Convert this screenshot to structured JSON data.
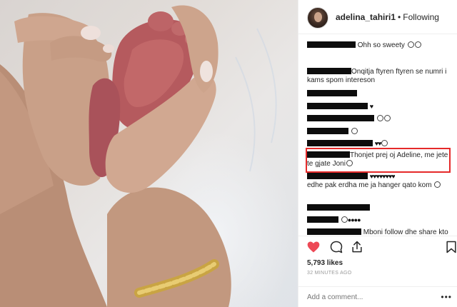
{
  "post": {
    "username": "adelina_tahiri1",
    "separator": "•",
    "follow_status": "Following"
  },
  "comments": [
    {
      "text": "Ohh so sweety"
    },
    {
      "text": "Onqitja ftyren ftyren se numri i kams spom intereson"
    },
    {
      "text": ""
    },
    {
      "text": ""
    },
    {
      "text": ""
    },
    {
      "text": ""
    },
    {
      "text": ""
    },
    {
      "text": "Thonjet prej oj Adeline, me jete te gjate Joni"
    },
    {
      "text": "edhe pak erdha me ja hanger qato kom"
    },
    {
      "text": ""
    },
    {
      "text": ""
    },
    {
      "text": "Mboni follow dhe share kto faqe e shte hap per kenaqesine e"
    }
  ],
  "stats": {
    "likes": "5,793 likes",
    "time_ago": "32 MINUTES AGO"
  },
  "composer": {
    "placeholder": "Add a comment...",
    "more": "•••"
  },
  "colors": {
    "highlight": "#e52a2a",
    "like_heart": "#ed4956"
  },
  "icons": [
    "heart-icon",
    "comment-icon",
    "share-icon",
    "bookmark-icon",
    "more-icon"
  ]
}
